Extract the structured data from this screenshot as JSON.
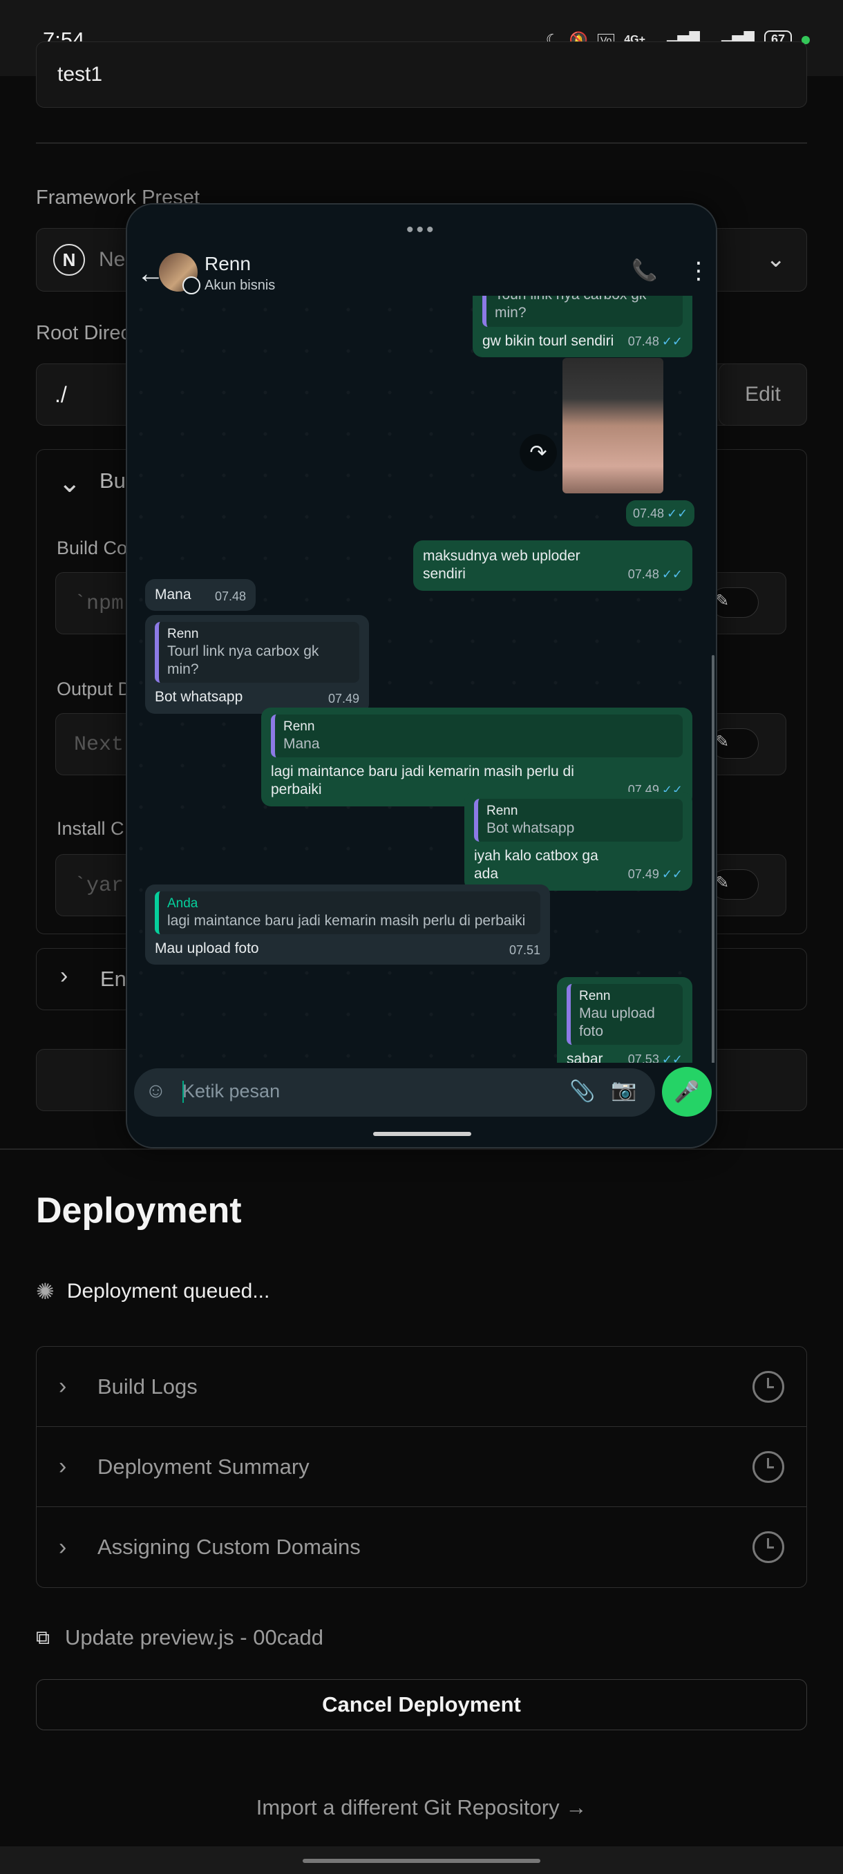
{
  "status_bar": {
    "time": "7:54",
    "network": "4G+",
    "battery": "67",
    "icons": [
      "moon-icon",
      "mute-icon",
      "volte-icon",
      "signal-icon",
      "signal-icon-2"
    ]
  },
  "vercel": {
    "project_name_value": "test1",
    "framework_label": "Framework Preset",
    "framework_value": "Ne",
    "root_dir_label": "Root Direc",
    "root_dir_value": "./",
    "edit_label": "Edit",
    "build_section_label": "Bu",
    "build_cmd_label": "Build Co",
    "build_cmd_placeholder": "`npm",
    "output_dir_label": "Output D",
    "output_dir_placeholder": "Next",
    "install_cmd_label": "Install C",
    "install_cmd_placeholder": "`yar",
    "env_section_label": "En",
    "deployment_title": "Deployment",
    "deployment_status": "Deployment queued...",
    "accordion": [
      {
        "label": "Build Logs"
      },
      {
        "label": "Deployment Summary"
      },
      {
        "label": "Assigning Custom Domains"
      }
    ],
    "commit_text": "Update preview.js - 00cadd",
    "cancel_label": "Cancel Deployment",
    "import_link": "Import a different Git Repository →"
  },
  "whatsapp": {
    "contact_name": "Renn",
    "contact_sub": "Akun bisnis",
    "input_placeholder": "Ketik pesan",
    "messages": {
      "m1_quote_text": "Tourl link nya carbox gk min?",
      "m1_text": "gw bikin tourl sendiri",
      "m1_time": "07.48",
      "m2_time": "07.48",
      "m3_text": "maksudnya web uploder sendiri",
      "m3_time": "07.48",
      "m4_text": "Mana",
      "m4_time": "07.48",
      "m5_quote_name": "Renn",
      "m5_quote_text": "Tourl link nya carbox gk min?",
      "m5_text": "Bot whatsapp",
      "m5_time": "07.49",
      "m6_quote_name": "Renn",
      "m6_quote_text": "Mana",
      "m6_text": "lagi maintance baru jadi kemarin masih perlu di perbaiki",
      "m6_time": "07.49",
      "m7_quote_name": "Renn",
      "m7_quote_text": "Bot whatsapp",
      "m7_text": "iyah kalo catbox ga ada",
      "m7_time": "07.49",
      "m8_quote_name": "Anda",
      "m8_quote_text": "lagi maintance baru jadi kemarin masih perlu di perbaiki",
      "m8_text": "Mau upload foto",
      "m8_time": "07.51",
      "m9_quote_name": "Renn",
      "m9_quote_text": "Mau upload foto",
      "m9_text": "sabar",
      "m9_time": "07.53"
    }
  },
  "colors": {
    "wa_outgoing": "#144d37",
    "wa_incoming": "#202c33",
    "wa_read_ticks": "#53bdeb",
    "wa_mic": "#25d366"
  }
}
